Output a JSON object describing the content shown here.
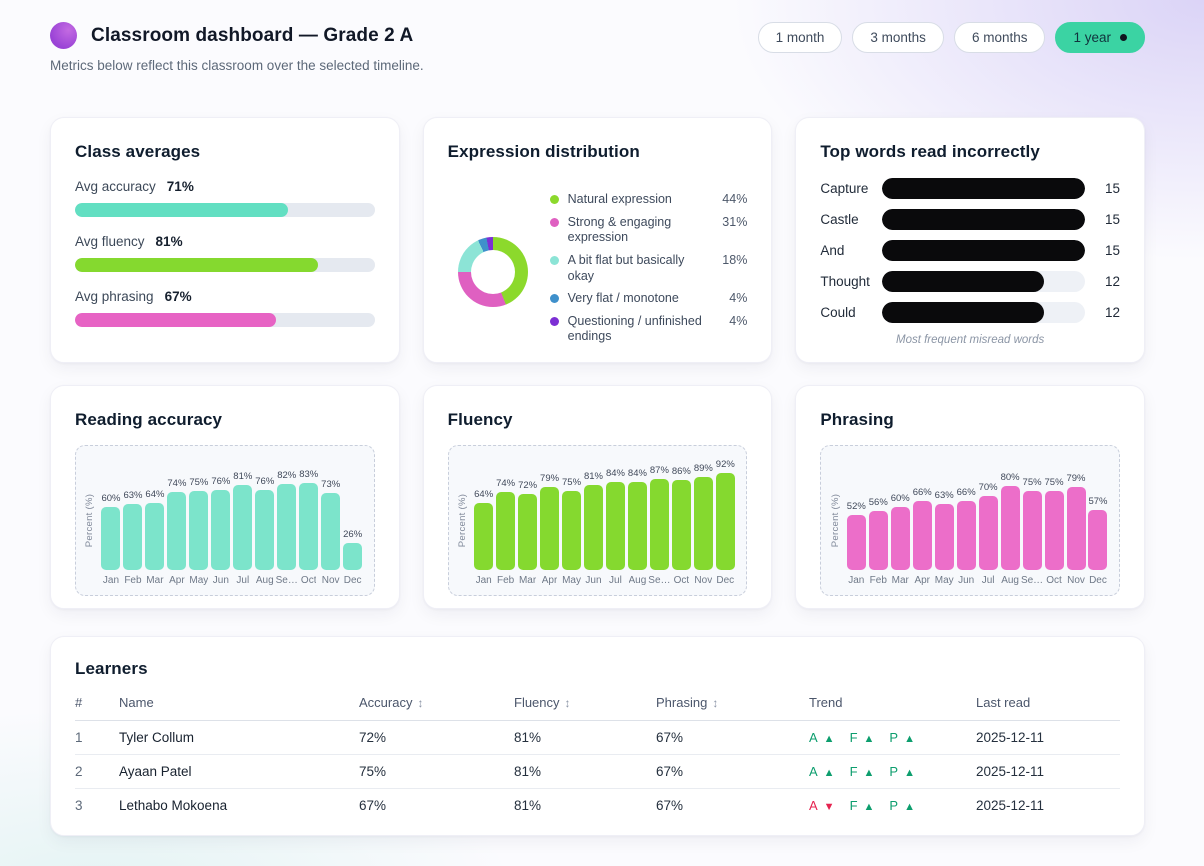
{
  "header": {
    "title": "Classroom dashboard — Grade 2 A",
    "subtitle": "Metrics below reflect this classroom over the selected timeline.",
    "logo_color": "#a24fd8",
    "timeline_options": [
      {
        "label": "1 month",
        "active": false
      },
      {
        "label": "3 months",
        "active": false
      },
      {
        "label": "6 months",
        "active": false
      },
      {
        "label": "1 year",
        "active": true
      }
    ],
    "active_pill_color": "#3bd3a3"
  },
  "class_averages": {
    "title": "Class averages",
    "metrics": [
      {
        "label": "Avg accuracy",
        "value": "71%",
        "percent": 71,
        "color": "#62dfc2"
      },
      {
        "label": "Avg fluency",
        "value": "81%",
        "percent": 81,
        "color": "#85d92f"
      },
      {
        "label": "Avg phrasing",
        "value": "67%",
        "percent": 67,
        "color": "#e763c4"
      }
    ]
  },
  "expression": {
    "title": "Expression distribution",
    "type": "donut",
    "segments": [
      {
        "label": "Natural expression",
        "value": "44%",
        "percent": 44,
        "color": "#8cd92c"
      },
      {
        "label": "Strong & engaging expression",
        "value": "31%",
        "percent": 31,
        "color": "#df60c1"
      },
      {
        "label": "A bit flat but basically okay",
        "value": "18%",
        "percent": 18,
        "color": "#8ce4d6"
      },
      {
        "label": "Very flat / monotone",
        "value": "4%",
        "percent": 4,
        "color": "#3f90cb"
      },
      {
        "label": "Questioning / unfinished endings",
        "value": "4%",
        "percent": 4,
        "color": "#7c2fd4"
      }
    ]
  },
  "top_words": {
    "title": "Top words read incorrectly",
    "type": "bar",
    "max": 15,
    "bar_color": "#0a0a0c",
    "items": [
      {
        "word": "Capture",
        "count": 15
      },
      {
        "word": "Castle",
        "count": 15
      },
      {
        "word": "And",
        "count": 15
      },
      {
        "word": "Thought",
        "count": 12
      },
      {
        "word": "Could",
        "count": 12
      }
    ],
    "caption": "Most frequent misread words"
  },
  "chart_data": [
    {
      "type": "bar",
      "title": "Reading accuracy",
      "ylabel": "Percent (%)",
      "ylim": [
        0,
        100
      ],
      "color": "#7ce4cb",
      "months": [
        "Jan",
        "Feb",
        "Mar",
        "Apr",
        "May",
        "Jun",
        "Jul",
        "Aug",
        "Se…",
        "Oct",
        "Nov",
        "Dec"
      ],
      "values": [
        60,
        63,
        64,
        74,
        75,
        76,
        81,
        76,
        82,
        83,
        73,
        26
      ],
      "labels": [
        "60%",
        "63%",
        "64%",
        "74%",
        "75%",
        "76%",
        "81%",
        "76%",
        "82%",
        "83%",
        "73%",
        "26%"
      ]
    },
    {
      "type": "bar",
      "title": "Fluency",
      "ylabel": "Percent (%)",
      "ylim": [
        0,
        100
      ],
      "color": "#85d92f",
      "months": [
        "Jan",
        "Feb",
        "Mar",
        "Apr",
        "May",
        "Jun",
        "Jul",
        "Aug",
        "Se…",
        "Oct",
        "Nov",
        "Dec"
      ],
      "values": [
        64,
        74,
        72,
        79,
        75,
        81,
        84,
        84,
        87,
        86,
        89,
        92
      ],
      "labels": [
        "64%",
        "74%",
        "72%",
        "79%",
        "75%",
        "81%",
        "84%",
        "84%",
        "87%",
        "86%",
        "89%",
        "92%"
      ]
    },
    {
      "type": "bar",
      "title": "Phrasing",
      "ylabel": "Percent (%)",
      "ylim": [
        0,
        100
      ],
      "color": "#ec6ec9",
      "months": [
        "Jan",
        "Feb",
        "Mar",
        "Apr",
        "May",
        "Jun",
        "Jul",
        "Aug",
        "Se…",
        "Oct",
        "Nov",
        "Dec"
      ],
      "values": [
        52,
        56,
        60,
        66,
        63,
        66,
        70,
        80,
        75,
        75,
        79,
        57
      ],
      "labels": [
        "52%",
        "56%",
        "60%",
        "66%",
        "63%",
        "66%",
        "70%",
        "80%",
        "75%",
        "75%",
        "79%",
        "57%"
      ]
    }
  ],
  "learners": {
    "title": "Learners",
    "sort_icon": "↕",
    "columns": [
      {
        "label": "#",
        "sortable": false
      },
      {
        "label": "Name",
        "sortable": false
      },
      {
        "label": "Accuracy",
        "sortable": true
      },
      {
        "label": "Fluency",
        "sortable": true
      },
      {
        "label": "Phrasing",
        "sortable": true
      },
      {
        "label": "Trend",
        "sortable": false
      },
      {
        "label": "Last read",
        "sortable": false
      }
    ],
    "rows": [
      {
        "num": "1",
        "name": "Tyler Collum",
        "accuracy": "72%",
        "fluency": "81%",
        "phrasing": "67%",
        "trend": [
          {
            "letter": "A",
            "arrow": "▲",
            "color": "#0d9e6e"
          },
          {
            "letter": "F",
            "arrow": "▲",
            "color": "#0d9e6e"
          },
          {
            "letter": "P",
            "arrow": "▲",
            "color": "#0d9e6e"
          }
        ],
        "last_read": "2025-12-11"
      },
      {
        "num": "2",
        "name": "Ayaan Patel",
        "accuracy": "75%",
        "fluency": "81%",
        "phrasing": "67%",
        "trend": [
          {
            "letter": "A",
            "arrow": "▲",
            "color": "#0d9e6e"
          },
          {
            "letter": "F",
            "arrow": "▲",
            "color": "#0d9e6e"
          },
          {
            "letter": "P",
            "arrow": "▲",
            "color": "#0d9e6e"
          }
        ],
        "last_read": "2025-12-11"
      },
      {
        "num": "3",
        "name": "Lethabo Mokoena",
        "accuracy": "67%",
        "fluency": "81%",
        "phrasing": "67%",
        "trend": [
          {
            "letter": "A",
            "arrow": "▼",
            "color": "#e5234f"
          },
          {
            "letter": "F",
            "arrow": "▲",
            "color": "#0d9e6e"
          },
          {
            "letter": "P",
            "arrow": "▲",
            "color": "#0d9e6e"
          }
        ],
        "last_read": "2025-12-11"
      }
    ]
  }
}
